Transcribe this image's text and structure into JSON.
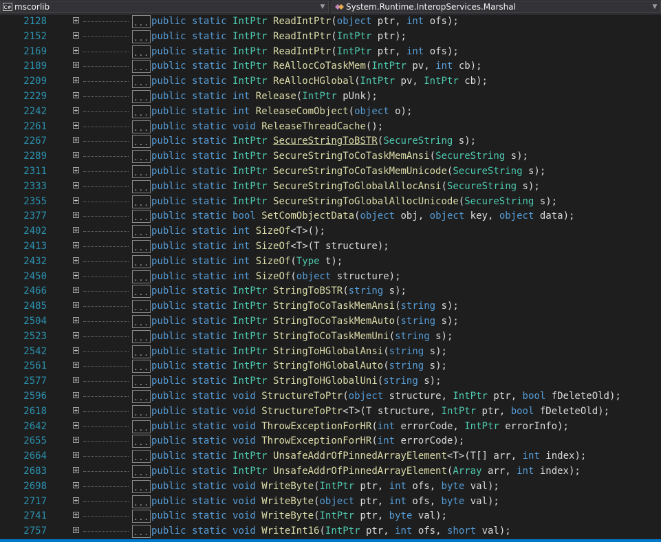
{
  "toolbar": {
    "assembly": "mscorlib",
    "assembly_icon": "csharp-file-icon",
    "type_name": "System.Runtime.InteropServices.Marshal",
    "type_icon": "class-icon"
  },
  "collapse_placeholder": "...",
  "colors": {
    "background": "#1e1e1e",
    "line_number": "#2b91af",
    "keyword": "#569cd6",
    "type": "#4ec9b0",
    "method": "#dcdcaa",
    "text": "#dcdcdc"
  },
  "lines": [
    {
      "num": "2128",
      "code": "public static IntPtr ReadIntPtr(object ptr, int ofs);"
    },
    {
      "num": "2152",
      "code": "public static IntPtr ReadIntPtr(IntPtr ptr);"
    },
    {
      "num": "2169",
      "code": "public static IntPtr ReadIntPtr(IntPtr ptr, int ofs);"
    },
    {
      "num": "2189",
      "code": "public static IntPtr ReAllocCoTaskMem(IntPtr pv, int cb);"
    },
    {
      "num": "2209",
      "code": "public static IntPtr ReAllocHGlobal(IntPtr pv, IntPtr cb);"
    },
    {
      "num": "2229",
      "code": "public static int Release(IntPtr pUnk);"
    },
    {
      "num": "2242",
      "code": "public static int ReleaseComObject(object o);"
    },
    {
      "num": "2261",
      "code": "public static void ReleaseThreadCache();"
    },
    {
      "num": "2267",
      "code": "public static IntPtr SecureStringToBSTR(SecureString s);"
    },
    {
      "num": "2289",
      "code": "public static IntPtr SecureStringToCoTaskMemAnsi(SecureString s);"
    },
    {
      "num": "2311",
      "code": "public static IntPtr SecureStringToCoTaskMemUnicode(SecureString s);"
    },
    {
      "num": "2333",
      "code": "public static IntPtr SecureStringToGlobalAllocAnsi(SecureString s);"
    },
    {
      "num": "2355",
      "code": "public static IntPtr SecureStringToGlobalAllocUnicode(SecureString s);"
    },
    {
      "num": "2377",
      "code": "public static bool SetComObjectData(object obj, object key, object data);"
    },
    {
      "num": "2402",
      "code": "public static int SizeOf<T>();"
    },
    {
      "num": "2413",
      "code": "public static int SizeOf<T>(T structure);"
    },
    {
      "num": "2432",
      "code": "public static int SizeOf(Type t);"
    },
    {
      "num": "2450",
      "code": "public static int SizeOf(object structure);"
    },
    {
      "num": "2466",
      "code": "public static IntPtr StringToBSTR(string s);"
    },
    {
      "num": "2485",
      "code": "public static IntPtr StringToCoTaskMemAnsi(string s);"
    },
    {
      "num": "2504",
      "code": "public static IntPtr StringToCoTaskMemAuto(string s);"
    },
    {
      "num": "2523",
      "code": "public static IntPtr StringToCoTaskMemUni(string s);"
    },
    {
      "num": "2542",
      "code": "public static IntPtr StringToHGlobalAnsi(string s);"
    },
    {
      "num": "2561",
      "code": "public static IntPtr StringToHGlobalAuto(string s);"
    },
    {
      "num": "2577",
      "code": "public static IntPtr StringToHGlobalUni(string s);"
    },
    {
      "num": "2596",
      "code": "public static void StructureToPtr(object structure, IntPtr ptr, bool fDeleteOld);"
    },
    {
      "num": "2618",
      "code": "public static void StructureToPtr<T>(T structure, IntPtr ptr, bool fDeleteOld);"
    },
    {
      "num": "2642",
      "code": "public static void ThrowExceptionForHR(int errorCode, IntPtr errorInfo);"
    },
    {
      "num": "2655",
      "code": "public static void ThrowExceptionForHR(int errorCode);"
    },
    {
      "num": "2664",
      "code": "public static IntPtr UnsafeAddrOfPinnedArrayElement<T>(T[] arr, int index);"
    },
    {
      "num": "2683",
      "code": "public static IntPtr UnsafeAddrOfPinnedArrayElement(Array arr, int index);"
    },
    {
      "num": "2698",
      "code": "public static void WriteByte(IntPtr ptr, int ofs, byte val);"
    },
    {
      "num": "2717",
      "code": "public static void WriteByte(object ptr, int ofs, byte val);"
    },
    {
      "num": "2741",
      "code": "public static void WriteByte(IntPtr ptr, byte val);"
    },
    {
      "num": "2757",
      "code": "public static void WriteInt16(IntPtr ptr, int ofs, short val);"
    }
  ]
}
